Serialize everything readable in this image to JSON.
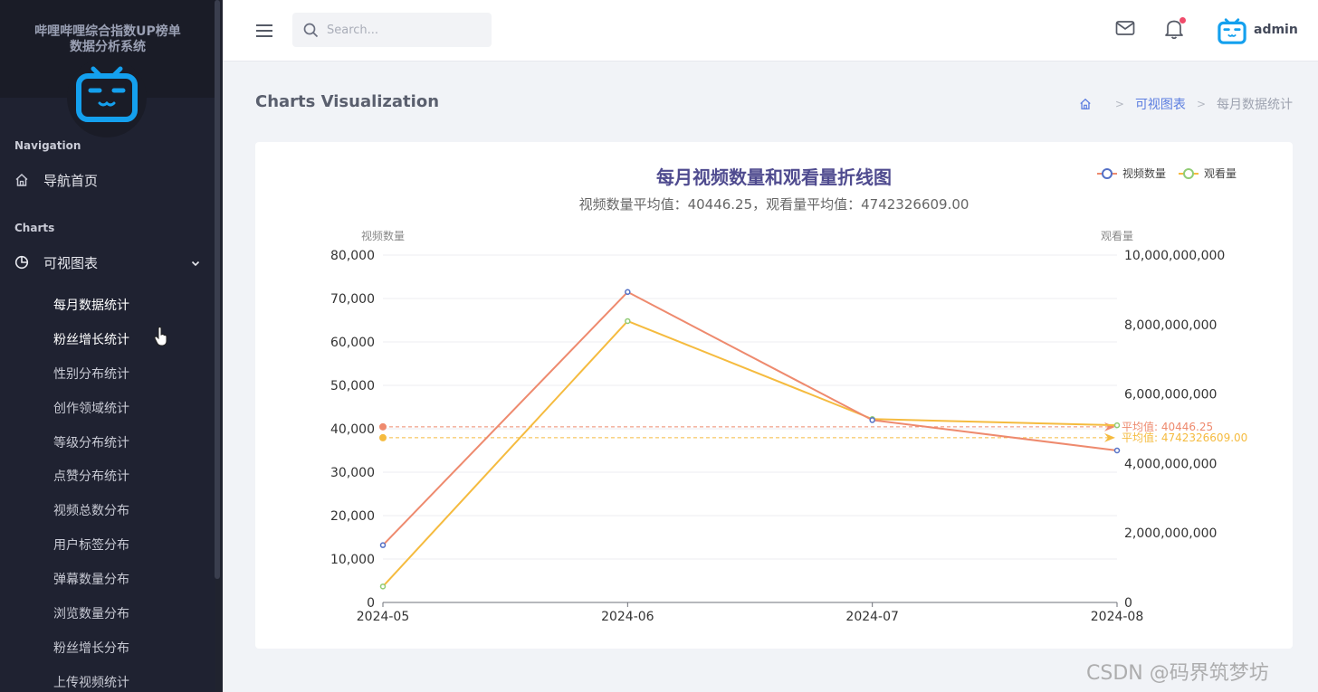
{
  "sidebar": {
    "brand_line1": "哔哩哔哩综合指数UP榜单",
    "brand_line2": "数据分析系统",
    "nav_section": "Navigation",
    "home_label": "导航首页",
    "charts_section": "Charts",
    "charts_label": "可视图表",
    "sub_items": [
      "每月数据统计",
      "粉丝增长统计",
      "性别分布统计",
      "创作领域统计",
      "等级分布统计",
      "点赞分布统计",
      "视频总数分布",
      "用户标签分布",
      "弹幕数量分布",
      "浏览数量分布",
      "粉丝增长分布",
      "上传视频统计"
    ]
  },
  "topbar": {
    "search_placeholder": "Search...",
    "username": "admin"
  },
  "page": {
    "title": "Charts Visualization",
    "breadcrumb_link": "可视图表",
    "breadcrumb_current": "每月数据统计"
  },
  "watermark": "CSDN @码界筑梦坊",
  "colors": {
    "sidebar_bg": "#1f2231",
    "video_line": "#ee8a6e",
    "view_line": "#f5bb3f",
    "video_point": "#5470c6",
    "view_point": "#91cc75",
    "title": "#4f4b8f"
  },
  "chart_data": {
    "type": "line",
    "title": "每月视频数量和观看量折线图",
    "subtitle": "视频数量平均值：40446.25，观看量平均值：4742326609.00",
    "legend": [
      "视频数量",
      "观看量"
    ],
    "legend_position": "top-right",
    "categories": [
      "2024-05",
      "2024-06",
      "2024-07",
      "2024-08"
    ],
    "y_left": {
      "label": "视频数量",
      "min": 0,
      "max": 80000,
      "ticks": [
        "0",
        "10,000",
        "20,000",
        "30,000",
        "40,000",
        "50,000",
        "60,000",
        "70,000",
        "80,000"
      ]
    },
    "y_right": {
      "label": "观看量",
      "min": 0,
      "max": 10000000000,
      "ticks": [
        "0",
        "2,000,000,000",
        "4,000,000,000",
        "6,000,000,000",
        "8,000,000,000",
        "10,000,000,000"
      ]
    },
    "series": [
      {
        "name": "视频数量",
        "axis": "left",
        "values": [
          13200,
          71500,
          42000,
          35000
        ],
        "avg": 40446.25,
        "avg_label": "平均值: 40446.25"
      },
      {
        "name": "观看量",
        "axis": "right",
        "values": [
          460000000,
          8100000000,
          5280000000,
          5100000000
        ],
        "avg": 4742326609.0,
        "avg_label": "平均值: 4742326609.00"
      }
    ]
  }
}
